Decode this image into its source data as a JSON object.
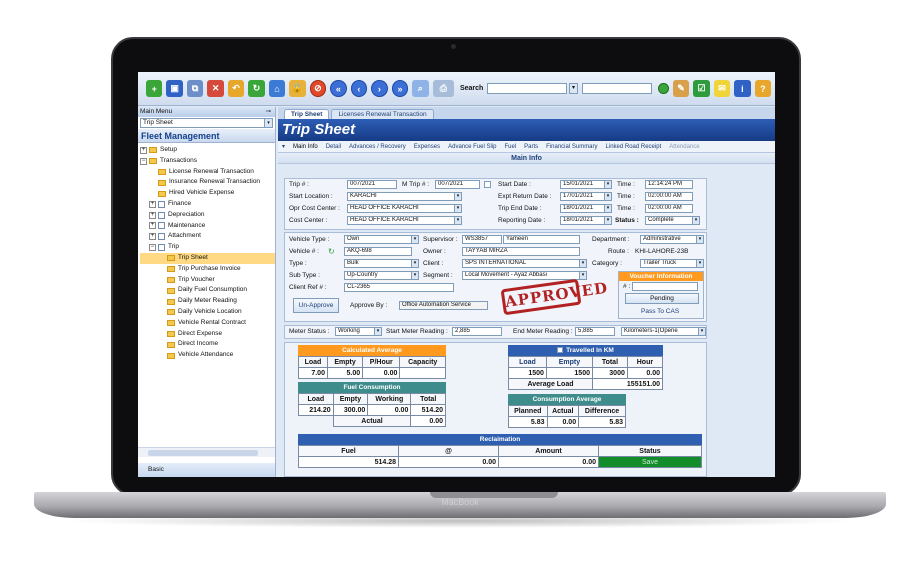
{
  "device": {
    "brand": "MacBook"
  },
  "toolbar": {
    "search_label": "Search"
  },
  "sidebar": {
    "main_menu_label": "Main Menu",
    "selected_menu": "Trip Sheet",
    "section_title": "Fleet Management",
    "items": [
      "Setup",
      "Transactions",
      "License Renewal Transaction",
      "Insurance Renewal Transaction",
      "Hired Vehicle Expense",
      "Finance",
      "Depreciation",
      "Maintenance",
      "Attachment",
      "Trip",
      "Trip Sheet",
      "Trip Purchase Invoice",
      "Trip Voucher",
      "Daily Fuel Consumption",
      "Daily Meter Reading",
      "Daily Vehicle Location",
      "Vehicle Rental Contract",
      "Direct Expense",
      "Direct Income",
      "Vehicle Attendance"
    ],
    "bottom_label": "Basic"
  },
  "tabs": [
    "Trip Sheet",
    "Licenses Renewal Transaction"
  ],
  "page_title": "Trip Sheet",
  "subtabs": [
    "Main Info",
    "Detail",
    "Advances / Recovery",
    "Expenses",
    "Advance Fuel Slip",
    "Fuel",
    "Parts",
    "Financial Summary",
    "Linked Road Receipt",
    "Attendance"
  ],
  "section_header": "Main Info",
  "trip": {
    "trip_no_label": "Trip # :",
    "trip_no": "007/2021",
    "mtrip_label": "M Trip # :",
    "mtrip": "007/2021",
    "start_location_label": "Start Location :",
    "start_location": "KARACHI",
    "opr_cost_center_label": "Opr Cost Center :",
    "opr_cost_center": "HEAD OFFICE KARACHI",
    "cost_center_label": "Cost Center :",
    "cost_center": "HEAD OFFICE KARACHI",
    "start_date_label": "Start Date :",
    "start_date": "15/01/2021",
    "expt_return_label": "Expt Return Date :",
    "expt_return": "17/01/2021",
    "trip_end_label": "Trip End Date :",
    "trip_end": "18/01/2021",
    "reporting_label": "Reporting Date :",
    "reporting": "18/01/2021",
    "time_label": "Time :",
    "time1": "12:14:24 PM",
    "time2": "02:00:00 AM",
    "time3": "02:00:00 AM",
    "status_label": "Status :",
    "status": "Complete"
  },
  "vehicle": {
    "type_label": "Vehicle Type :",
    "type": "Own",
    "vehicle_label": "Vehicle # :",
    "vehicle": "AKQ-698",
    "ttype_label": "Type :",
    "ttype": "Bulk",
    "subtype_label": "Sub Type :",
    "subtype": "Up-Country",
    "client_ref_label": "Client Ref # :",
    "client_ref": "CL-2365",
    "supervisor_label": "Supervisor :",
    "supervisor_code": "WS3857",
    "supervisor_name": "Yameen",
    "owner_label": "Owner :",
    "owner": "TAYYAB MIRZA",
    "client_label": "Client :",
    "client": "SPS INTERNATIONAL",
    "segment_label": "Segment :",
    "segment": "Local Movement - Ayaz Abbasi",
    "department_label": "Department :",
    "department": "Administrative",
    "route_label": "Route :",
    "route": "KHI-LAHORE-23B",
    "category_label": "Category :",
    "category": "Trailer Truck",
    "unapprove": "Un-Approve",
    "approve_by_label": "Approve By :",
    "approve_by": "Office Automation Service",
    "stamp": "APPROVED",
    "voucher_info": "Voucher Information",
    "voucher_no_label": "# :",
    "pending": "Pending",
    "pass_to_cas": "Pass To CAS"
  },
  "meter": {
    "status_label": "Meter Status :",
    "status": "Working",
    "start_label": "Start Meter Reading :",
    "start": "2,885",
    "end_label": "End Meter Reading :",
    "end": "5,885",
    "unit": "Kilometers-1(Opene"
  },
  "calc_avg": {
    "title": "Calculated Average",
    "headers": [
      "Load",
      "Empty",
      "P/Hour",
      "Capacity"
    ],
    "values": [
      "7.00",
      "5.00",
      "0.00",
      ""
    ]
  },
  "travelled": {
    "title": "Travelled In KM",
    "headers": [
      "Load",
      "Empty",
      "Total",
      "Hour"
    ],
    "values": [
      "1500",
      "1500",
      "3000",
      "0.00"
    ],
    "avg_load_label": "Average Load",
    "avg_load": "155151.00"
  },
  "fuel_consumption": {
    "title": "Fuel Consumption",
    "headers": [
      "Load",
      "Empty",
      "Working",
      "Total"
    ],
    "values": [
      "214.20",
      "300.00",
      "0.00",
      "514.20"
    ],
    "actual_label": "Actual",
    "actual": "0.00"
  },
  "consumption_avg": {
    "title": "Consumption Average",
    "headers": [
      "Planned",
      "Actual",
      "Difference"
    ],
    "values": [
      "5.83",
      "0.00",
      "5.83"
    ]
  },
  "reclaimation": {
    "title": "Reclaimation",
    "headers": [
      "Fuel",
      "@",
      "Amount",
      "Status"
    ],
    "values": [
      "514.28",
      "0.00",
      "0.00",
      "Save"
    ]
  }
}
